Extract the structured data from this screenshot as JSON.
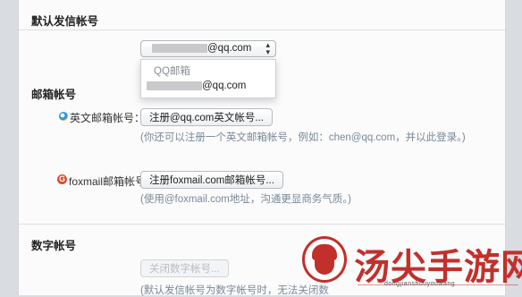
{
  "sections": {
    "default_sender": "默认发信帐号",
    "mailbox_accounts": "邮箱帐号",
    "digital_account": "数字帐号"
  },
  "sender_select": {
    "value_suffix": "@qq.com",
    "dropdown_group": "QQ邮箱",
    "dropdown_option_suffix": "@qq.com"
  },
  "english_account": {
    "label": "英文邮箱帐号：",
    "button": "注册@qq.com英文帐号...",
    "hint": "(你还可以注册一个英文邮箱帐号，例如：chen@qq.com，并以此登录。)"
  },
  "foxmail_account": {
    "label": "foxmail邮箱帐号：",
    "button": "注册foxmail.com邮箱帐号...",
    "hint": "(使用@foxmail.com地址，沟通更显商务气质。)"
  },
  "digital": {
    "button": "关闭数字帐号...",
    "hint": "(默认发信帐号为数字帐号时，无法关闭数"
  },
  "watermark": {
    "text": "汤尖手游网",
    "sub": "dongjianshouyouwang"
  },
  "colors": {
    "watermark": "#c2302c",
    "hint": "#7b8a99"
  }
}
